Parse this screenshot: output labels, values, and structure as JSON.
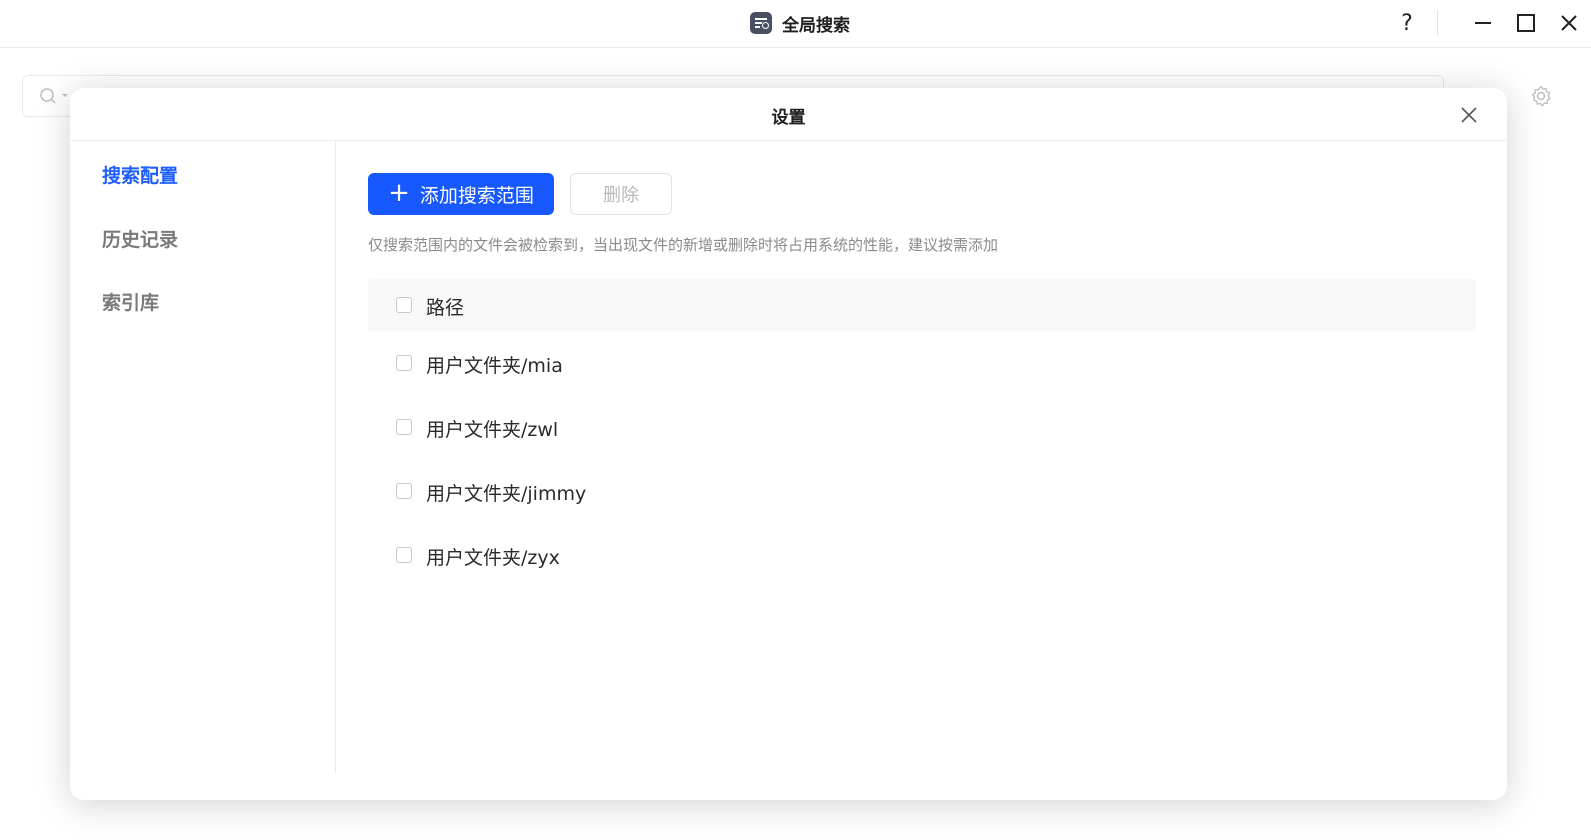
{
  "window": {
    "title": "全局搜索",
    "help_label": "?"
  },
  "dialog": {
    "title": "设置"
  },
  "sidebar": {
    "items": [
      {
        "label": "搜索配置",
        "active": true
      },
      {
        "label": "历史记录",
        "active": false
      },
      {
        "label": "索引库",
        "active": false
      }
    ]
  },
  "content": {
    "add_button_label": "添加搜索范围",
    "delete_button_label": "删除",
    "hint": "仅搜索范围内的文件会被检索到，当出现文件的新增或删除时将占用系统的性能，建议按需添加",
    "table": {
      "header": "路径",
      "rows": [
        "用户文件夹/mia",
        "用户文件夹/zwl",
        "用户文件夹/jimmy",
        "用户文件夹/zyx"
      ]
    }
  },
  "colors": {
    "accent": "#1759ff",
    "active_nav": "#1f5fff",
    "muted_text": "#8a8a8a"
  }
}
